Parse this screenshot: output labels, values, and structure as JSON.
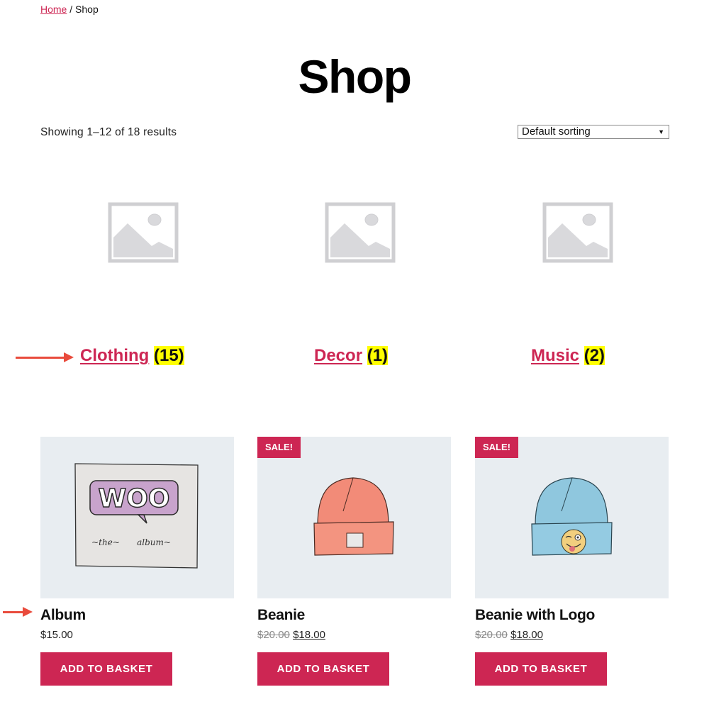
{
  "breadcrumb": {
    "home": "Home",
    "separator": " / ",
    "current": "Shop"
  },
  "page_title": "Shop",
  "result_count": "Showing 1–12 of 18 results",
  "ordering": {
    "selected": "Default sorting",
    "arrow": "▼"
  },
  "colors": {
    "accent": "#cd2653",
    "highlight": "#ffff00",
    "image_bg": "#e8edf1",
    "annotation_arrow": "#e94b3c"
  },
  "categories": [
    {
      "name": "Clothing",
      "count": "(15)",
      "image": "placeholder-image"
    },
    {
      "name": "Decor",
      "count": "(1)",
      "image": "placeholder-image"
    },
    {
      "name": "Music",
      "count": "(2)",
      "image": "placeholder-image"
    }
  ],
  "products": [
    {
      "title": "Album",
      "price": "$15.00",
      "on_sale": false,
      "image": "woo-album-cover",
      "button": "ADD TO BASKET"
    },
    {
      "title": "Beanie",
      "regular_price": "$20.00",
      "sale_price": "$18.00",
      "on_sale": true,
      "sale_badge": "SALE!",
      "image": "orange-beanie",
      "button": "ADD TO BASKET"
    },
    {
      "title": "Beanie with Logo",
      "regular_price": "$20.00",
      "sale_price": "$18.00",
      "on_sale": true,
      "sale_badge": "SALE!",
      "image": "blue-beanie-with-emoji-logo",
      "button": "ADD TO BASKET"
    }
  ],
  "album_art": {
    "logo_text": "WOO",
    "subtitle_left": "~the~",
    "subtitle_right": "album~"
  }
}
